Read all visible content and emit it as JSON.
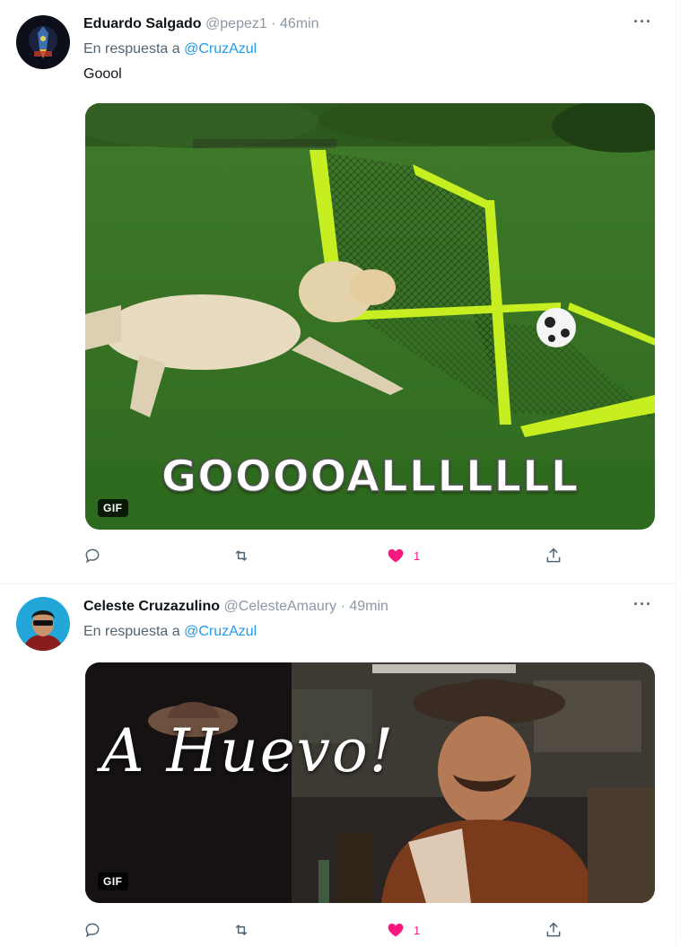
{
  "tweets": [
    {
      "author": {
        "display_name": "Eduardo Salgado",
        "handle": "@pepez1",
        "time": "· 46min"
      },
      "reply_prefix": "En respuesta a",
      "reply_to": "@CruzAzul",
      "text": "Goool",
      "media": {
        "badge": "GIF",
        "overlay_text": "GOOOOALLLLLLL"
      },
      "actions": {
        "likes": "1"
      }
    },
    {
      "author": {
        "display_name": "Celeste Cruzazulino",
        "handle": "@CelesteAmaury",
        "time": "· 49min"
      },
      "reply_prefix": "En respuesta a",
      "reply_to": "@CruzAzul",
      "text": "",
      "media": {
        "badge": "GIF",
        "overlay_text": "A Huevo!"
      },
      "actions": {
        "likes": "1"
      }
    }
  ],
  "more_glyph": "···",
  "icons": [
    "reply-icon",
    "retweet-icon",
    "like-heart-icon",
    "share-icon",
    "more-options-icon"
  ],
  "colors": {
    "accent": "#1d9bf0",
    "like": "#f91880",
    "muted": "#536471"
  }
}
